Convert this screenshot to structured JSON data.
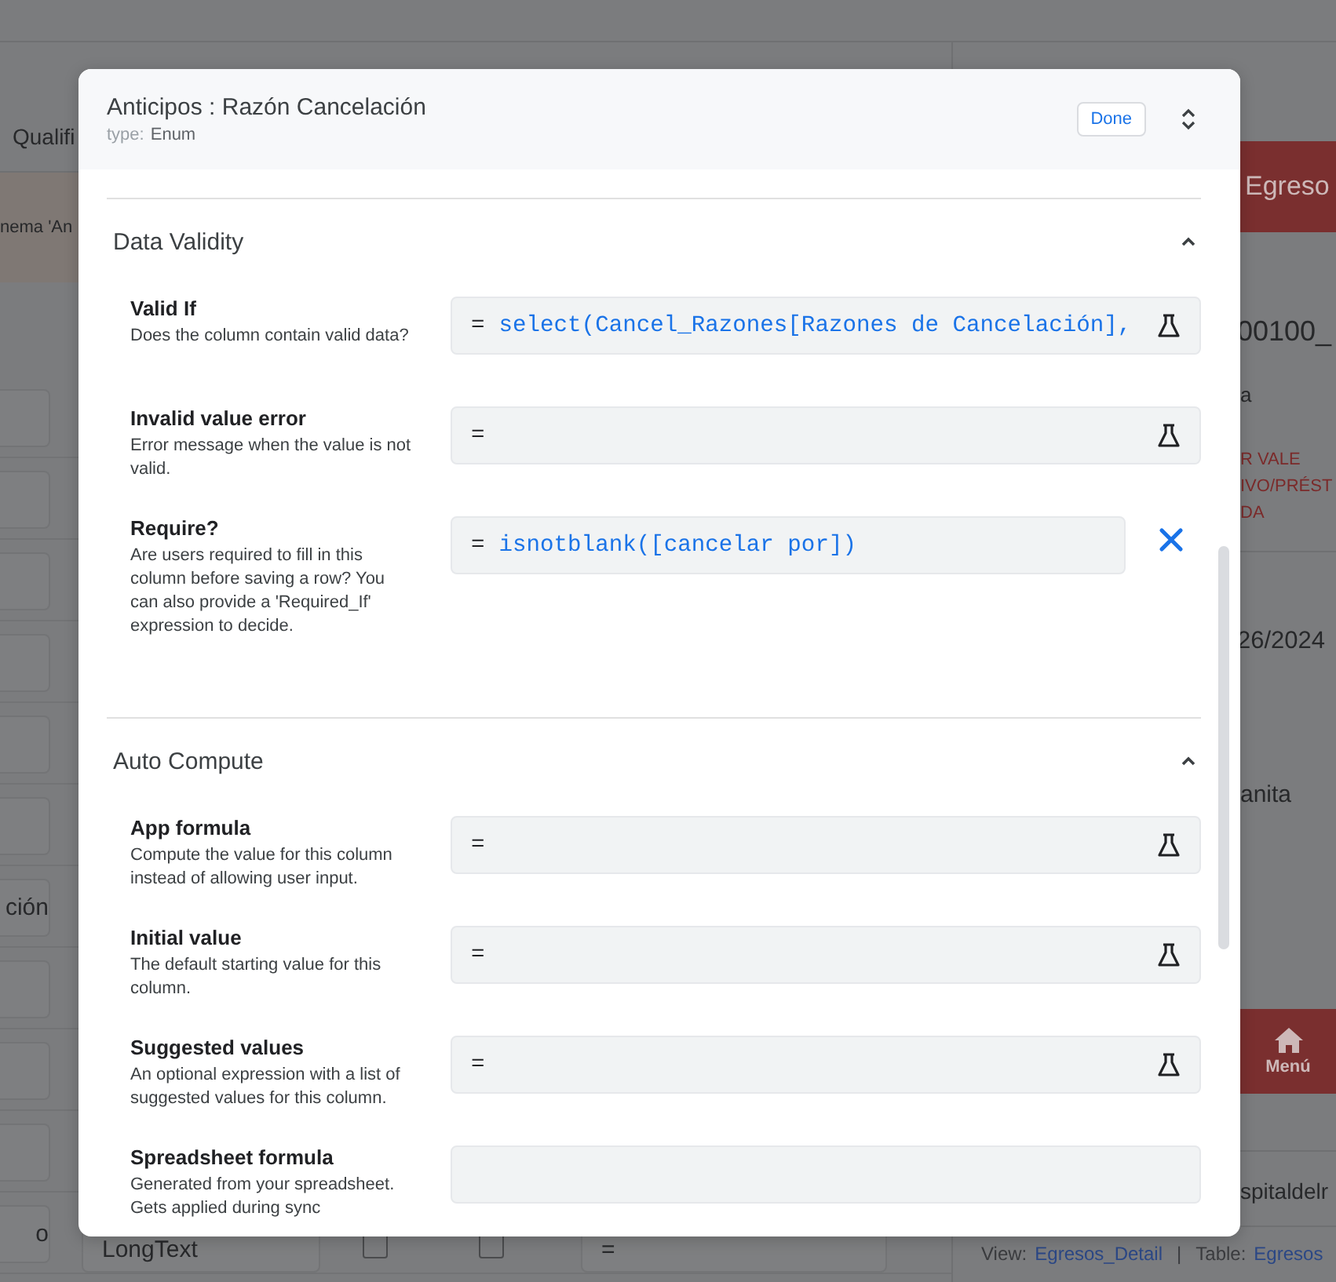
{
  "app": {
    "toolbar_tab": "Qualifi",
    "banner": "nema 'An",
    "rows": [
      {
        "kind": "blank"
      },
      {
        "kind": "blank"
      },
      {
        "kind": "blank"
      },
      {
        "kind": "blank"
      },
      {
        "kind": "blank"
      },
      {
        "kind": "blank"
      },
      {
        "kind": "text",
        "value": "ción"
      },
      {
        "kind": "blank"
      },
      {
        "kind": "blank"
      },
      {
        "kind": "blank"
      },
      {
        "kind": "column",
        "value": "o",
        "type": "LongText",
        "flags": [
          {
            "checked": false
          },
          {
            "checked": false
          }
        ],
        "formula": "="
      }
    ],
    "detail": {
      "header": "Egreso",
      "number": "00100_",
      "subtitle": "a",
      "notes": [
        "R VALE",
        "IVO/PRÉST",
        "DA"
      ],
      "date": "26/2024",
      "name": "anita",
      "menu_button": "Menú",
      "email": "spitaldelr"
    },
    "footer": {
      "view_label": "View:",
      "view_link": "Egresos_Detail",
      "separator": "|",
      "table_label": "Table:",
      "table_link": "Egresos"
    }
  },
  "dialog": {
    "title": "Anticipos : Razón Cancelación",
    "type_label": "type:",
    "type_value": "Enum",
    "done_button": "Done",
    "sections": [
      {
        "title": "Data Validity",
        "expanded": true,
        "fields": [
          {
            "label": "Valid If",
            "description": "Does the column contain valid data?",
            "prefix": "=",
            "expression": "select(Cancel_Razones[Razones de Cancelación],",
            "kind": "testable"
          },
          {
            "label": "Invalid value error",
            "description": "Error message when the value is not valid.",
            "prefix": "=",
            "kind": "testable"
          },
          {
            "label": "Require?",
            "description": "Are users required to fill in this column before saving a row? You can also provide a 'Required_If' expression to decide.",
            "prefix": "=",
            "expression": "isnotblank([cancelar por])",
            "kind": "clearable"
          }
        ]
      },
      {
        "title": "Auto Compute",
        "expanded": true,
        "fields": [
          {
            "label": "App formula",
            "description": "Compute the value for this column instead of allowing user input.",
            "prefix": "=",
            "kind": "testable"
          },
          {
            "label": "Initial value",
            "description": "The default starting value for this column.",
            "prefix": "=",
            "kind": "testable"
          },
          {
            "label": "Suggested values",
            "description": "An optional expression with a list of suggested values for this column.",
            "prefix": "=",
            "kind": "testable"
          },
          {
            "label": "Spreadsheet formula",
            "description": "Generated from your spreadsheet. Gets applied during sync",
            "kind": "plain"
          }
        ]
      }
    ]
  }
}
